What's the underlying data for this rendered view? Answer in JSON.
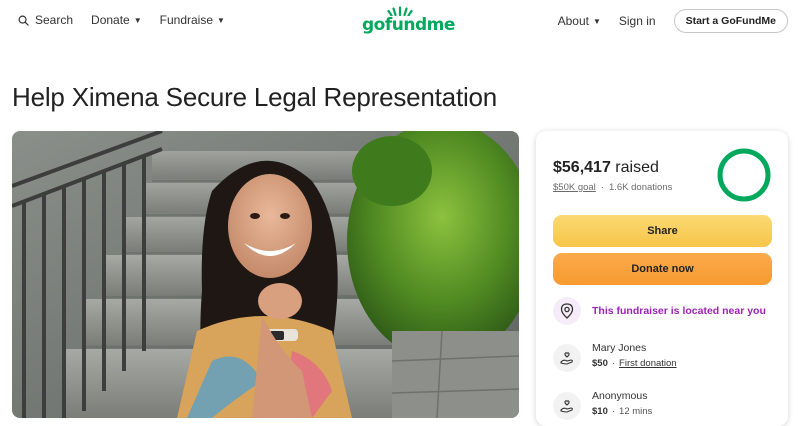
{
  "header": {
    "search_label": "Search",
    "donate_label": "Donate",
    "fundraise_label": "Fundraise",
    "logo_text": "gofundme",
    "about_label": "About",
    "signin_label": "Sign in",
    "start_label": "Start a GoFundMe"
  },
  "page": {
    "title": "Help Ximena Secure Legal Representation"
  },
  "donation_card": {
    "raised_amount": "$56,417",
    "raised_suffix": " raised",
    "goal": "$50K goal",
    "separator": "·",
    "donation_count": "1.6K donations",
    "progress_fraction": 1.0,
    "share_label": "Share",
    "donate_label": "Donate now",
    "near_text": "This fundraiser is located near you",
    "donors": [
      {
        "name": "Mary Jones",
        "amount": "$50",
        "sep": "·",
        "meta": "First donation"
      },
      {
        "name": "Anonymous",
        "amount": "$10",
        "sep": "·",
        "meta": "12 mins"
      }
    ]
  },
  "colors": {
    "brand_green": "#02a95c",
    "share_yellow": "#f7c548",
    "donate_orange": "#f79a30",
    "near_purple": "#9e22b9"
  }
}
